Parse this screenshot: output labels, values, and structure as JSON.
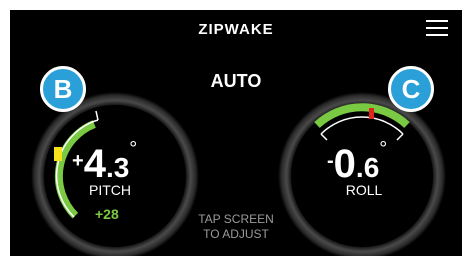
{
  "header": {
    "brand": "ZIPWAKE"
  },
  "mode": {
    "label": "AUTO"
  },
  "hint": {
    "line1": "TAP SCREEN",
    "line2": "TO ADJUST"
  },
  "pitch": {
    "badge": "B",
    "sign": "+",
    "int": "4",
    "dec": ".3",
    "degree": "°",
    "label": "PITCH",
    "trim": "+28"
  },
  "roll": {
    "badge": "C",
    "sign": "-",
    "int": "0",
    "dec": ".6",
    "degree": "°",
    "label": "ROLL"
  },
  "colors": {
    "background": "#000000",
    "accent_green": "#7ac943",
    "indicator_yellow": "#f7e11b",
    "indicator_red": "#e0261e",
    "badge_blue": "#2a9fd8",
    "bezel": "#3a3a3a"
  },
  "icons": {
    "menu": "hamburger-menu-icon"
  }
}
